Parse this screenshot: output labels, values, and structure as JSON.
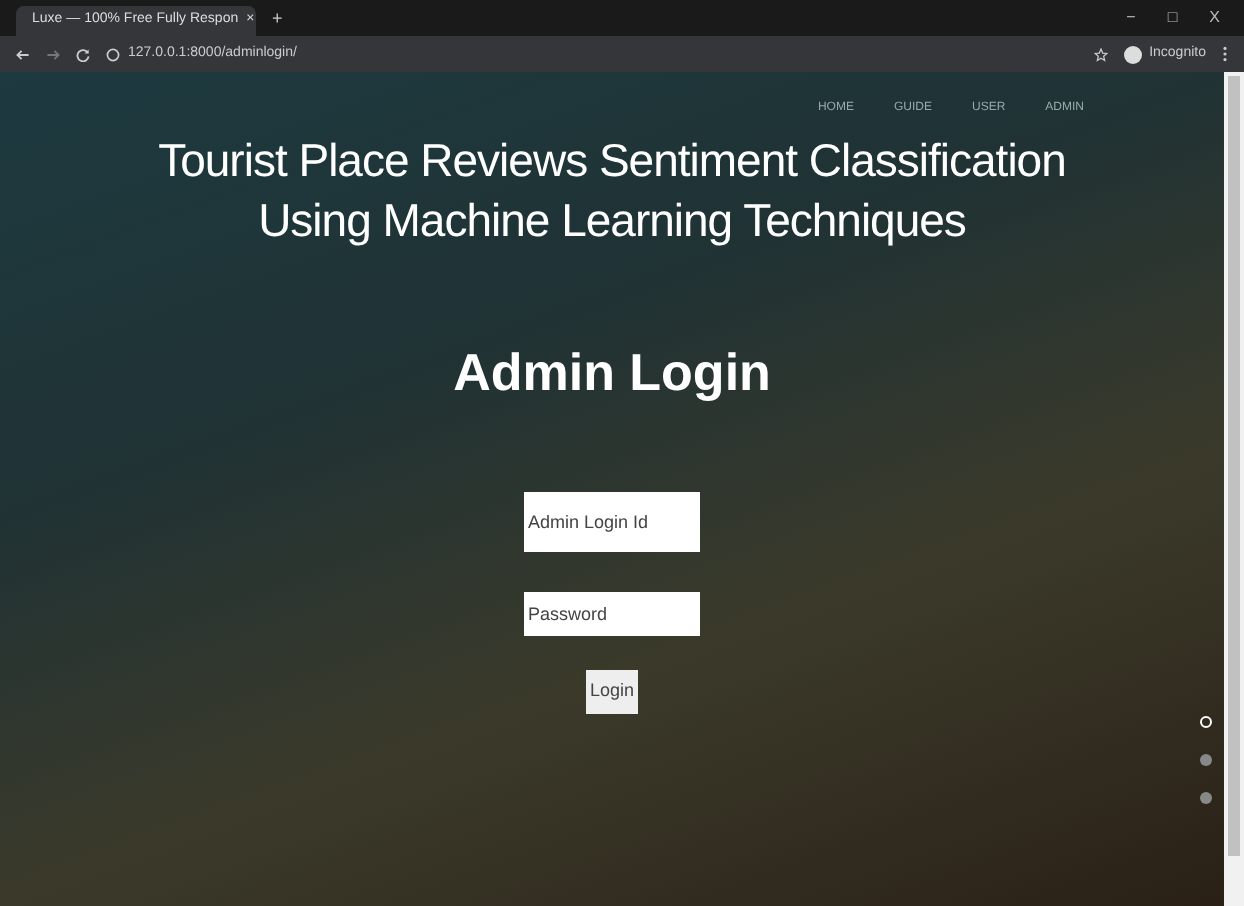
{
  "browser": {
    "tab_title": "Luxe — 100% Free Fully Respon",
    "tab_close": "×",
    "new_tab": "+",
    "url": "127.0.0.1:8000/adminlogin/",
    "profile": "Incognito",
    "window_controls": [
      "−",
      "□",
      "X"
    ]
  },
  "nav": [
    {
      "label": "HOME"
    },
    {
      "label": "GUIDE"
    },
    {
      "label": "USER"
    },
    {
      "label": "ADMIN"
    }
  ],
  "title": "Tourist Place Reviews Sentiment Classification Using Machine Learning Techniques",
  "heading": "Admin Login",
  "fields": [
    {
      "placeholder": "Admin Login Id"
    },
    {
      "placeholder": "Password"
    }
  ],
  "submit": "Login",
  "slider_dots": [
    {
      "selected": true
    },
    {
      "selected": false
    },
    {
      "selected": false
    }
  ]
}
